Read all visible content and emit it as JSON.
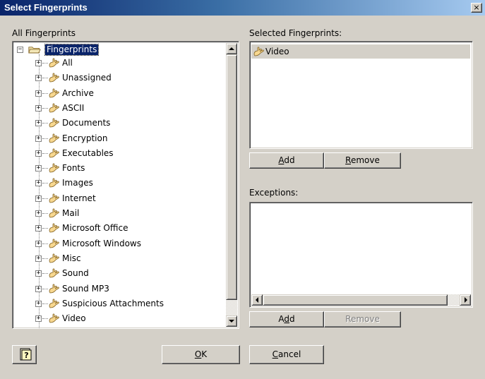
{
  "window": {
    "title": "Select Fingerprints",
    "close_label": "×"
  },
  "all_fingerprints": {
    "label": "All Fingerprints",
    "root": {
      "label": "Fingerprints",
      "expander": "−"
    },
    "items": [
      {
        "label": "All"
      },
      {
        "label": "Unassigned"
      },
      {
        "label": "Archive"
      },
      {
        "label": "ASCII"
      },
      {
        "label": "Documents"
      },
      {
        "label": "Encryption"
      },
      {
        "label": "Executables"
      },
      {
        "label": "Fonts"
      },
      {
        "label": "Images"
      },
      {
        "label": "Internet"
      },
      {
        "label": "Mail"
      },
      {
        "label": "Microsoft Office"
      },
      {
        "label": "Microsoft Windows"
      },
      {
        "label": "Misc"
      },
      {
        "label": "Sound"
      },
      {
        "label": "Sound MP3"
      },
      {
        "label": "Suspicious Attachments"
      },
      {
        "label": "Video"
      }
    ],
    "expander": "+"
  },
  "selected": {
    "label": "Selected Fingerprints:",
    "items": [
      {
        "label": "Video"
      }
    ],
    "add_label": "dd",
    "add_accel": "A",
    "remove_label": "emove",
    "remove_accel": "R"
  },
  "exceptions": {
    "label": "Exceptions:",
    "add_pre": "A",
    "add_accel": "d",
    "add_post": "d",
    "remove_label": "Remove"
  },
  "footer": {
    "ok_accel": "O",
    "ok_label": "K",
    "cancel_accel": "C",
    "cancel_label": "ancel",
    "help_icon": "help-icon"
  },
  "colors": {
    "titlebar_start": "#0a246a",
    "titlebar_end": "#a6caf0",
    "face": "#d4d0c8",
    "selection": "#0a246a"
  }
}
